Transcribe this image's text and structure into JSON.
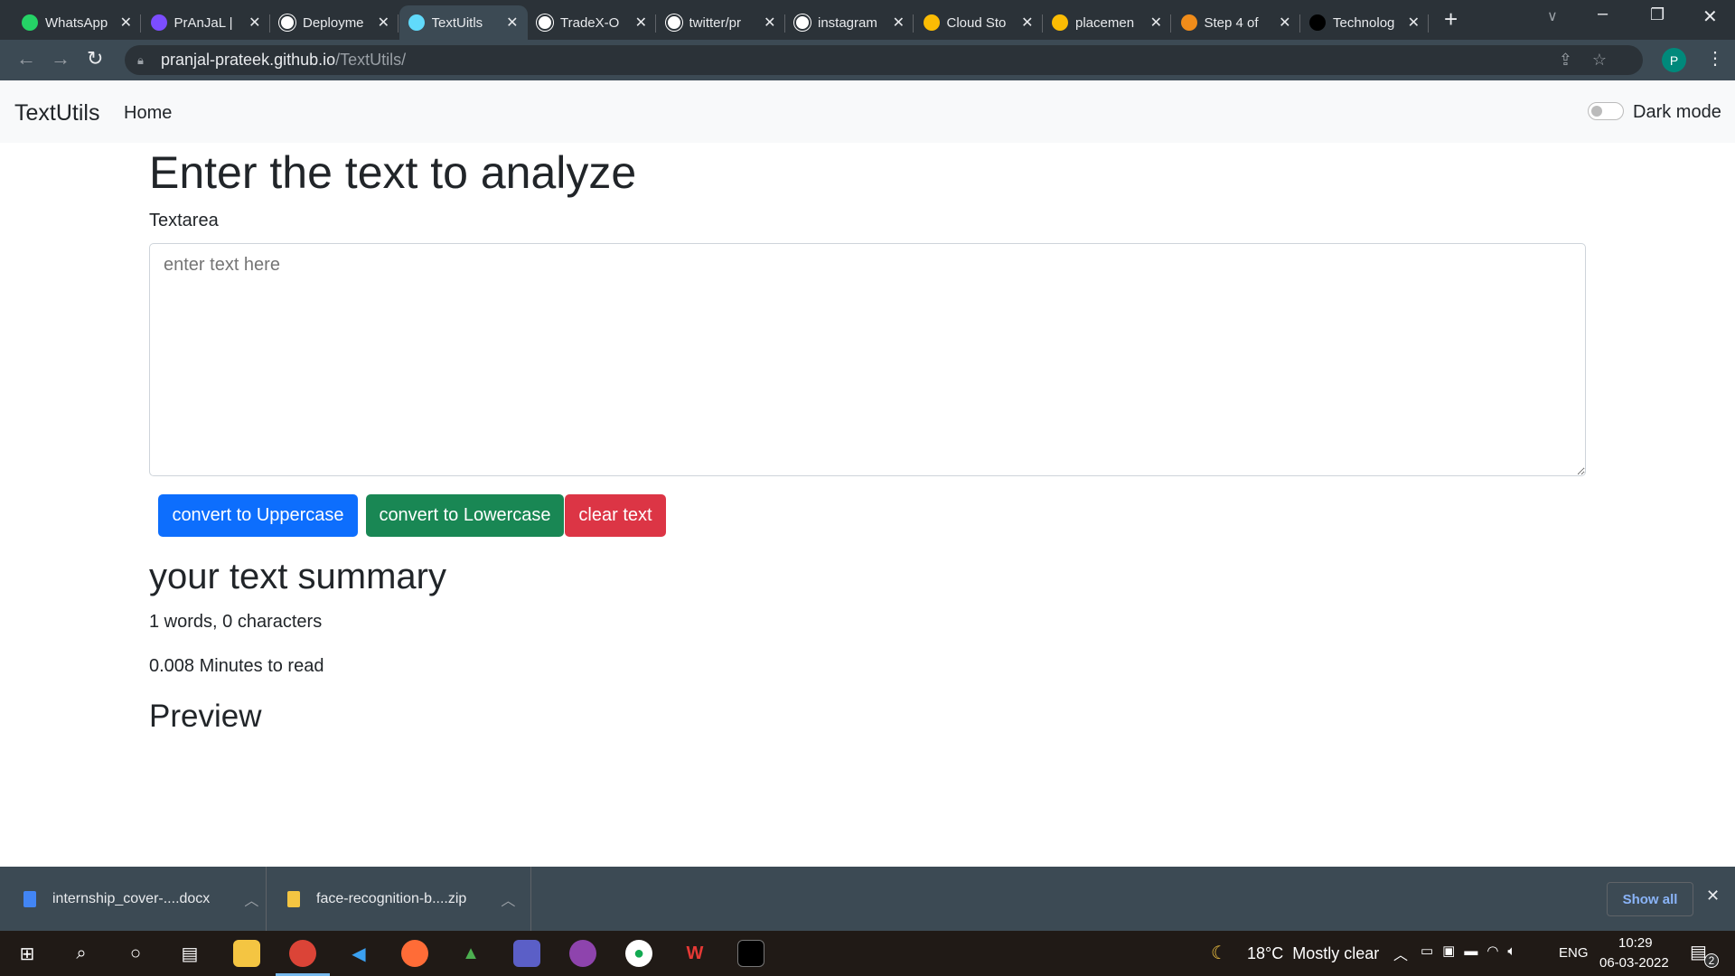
{
  "browser": {
    "tabs": [
      {
        "label": "WhatsApp",
        "icon": "whatsapp-icon",
        "color": "#25d366"
      },
      {
        "label": "PrAnJaL |",
        "icon": "profile-icon",
        "color": "#7c4dff"
      },
      {
        "label": "Deployme",
        "icon": "github-icon",
        "color": "#ffffff"
      },
      {
        "label": "TextUitls",
        "icon": "react-icon",
        "color": "#61dafb",
        "active": true
      },
      {
        "label": "TradeX-O",
        "icon": "globe-icon",
        "color": "#ffffff"
      },
      {
        "label": "twitter/pr",
        "icon": "google-icon",
        "color": "#ffffff"
      },
      {
        "label": "instagram",
        "icon": "google-icon",
        "color": "#ffffff"
      },
      {
        "label": "Cloud Sto",
        "icon": "drive-icon",
        "color": "#fbbc04"
      },
      {
        "label": "placemen",
        "icon": "drive-icon",
        "color": "#fbbc04"
      },
      {
        "label": "Step 4 of",
        "icon": "m-icon",
        "color": "#f08c1a"
      },
      {
        "label": "Technolog",
        "icon": "tech-icon",
        "color": "#000000"
      }
    ],
    "url_host": "pranjal-prateek.github.io",
    "url_path": "/TextUtils/",
    "profile_initial": "P"
  },
  "navbar": {
    "brand": "TextUtils",
    "home": "Home",
    "dark_mode_label": "Dark mode",
    "dark_mode_on": false
  },
  "main": {
    "heading": "Enter the text to analyze",
    "textarea_label": "Textarea",
    "textarea_placeholder": "enter text here",
    "textarea_value": "",
    "buttons": {
      "upper": "convert to Uppercase",
      "lower": "convert to Lowercase",
      "clear": "clear text"
    },
    "summary_heading": "your text summary",
    "counts": "1 words, 0 characters",
    "read_time": "0.008 Minutes to read",
    "preview_heading": "Preview"
  },
  "colors": {
    "primary": "#0d6efd",
    "success": "#198754",
    "danger": "#dc3545"
  },
  "downloads": {
    "items": [
      "internship_cover-....docx",
      "face-recognition-b....zip"
    ],
    "show_all": "Show all"
  },
  "taskbar": {
    "weather": "18°C  Mostly clear",
    "lang": "ENG",
    "time": "10:29",
    "date": "06-03-2022",
    "notifications": "2"
  }
}
